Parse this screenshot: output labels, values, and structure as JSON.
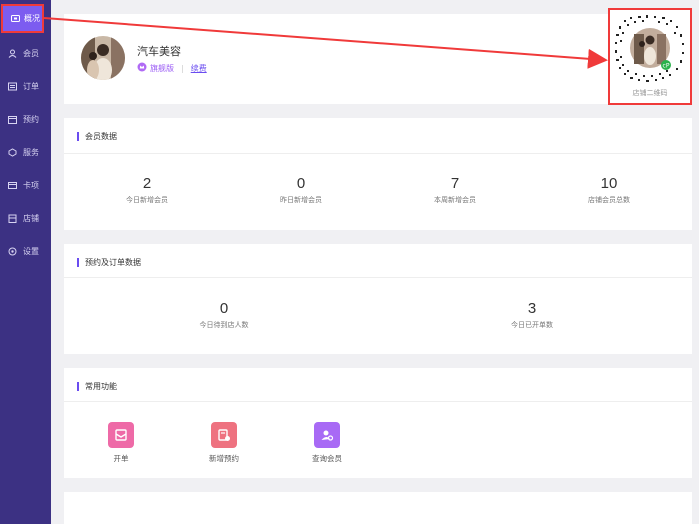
{
  "sidebar": {
    "items": [
      {
        "label": "概况",
        "icon": "dashboard-icon"
      },
      {
        "label": "会员",
        "icon": "member-icon"
      },
      {
        "label": "订单",
        "icon": "order-icon"
      },
      {
        "label": "预约",
        "icon": "appointment-icon"
      },
      {
        "label": "服务",
        "icon": "service-icon"
      },
      {
        "label": "卡项",
        "icon": "card-icon"
      },
      {
        "label": "店铺",
        "icon": "store-icon"
      },
      {
        "label": "设置",
        "icon": "settings-icon"
      }
    ]
  },
  "profile": {
    "shop_name": "汽车美容",
    "edition": "旗舰版",
    "renew": "续费",
    "qr_label": "店铺二维码"
  },
  "member_data": {
    "title": "会员数据",
    "stats": [
      {
        "value": "2",
        "label": "今日新增会员"
      },
      {
        "value": "0",
        "label": "昨日新增会员"
      },
      {
        "value": "7",
        "label": "本周新增会员"
      },
      {
        "value": "10",
        "label": "店铺会员总数"
      }
    ]
  },
  "booking_data": {
    "title": "预约及订单数据",
    "stats": [
      {
        "value": "0",
        "label": "今日待到店人数"
      },
      {
        "value": "3",
        "label": "今日已开单数"
      }
    ]
  },
  "functions": {
    "title": "常用功能",
    "items": [
      {
        "label": "开单",
        "color": "#ee6aa7"
      },
      {
        "label": "新增预约",
        "color": "#ee7280"
      },
      {
        "label": "查询会员",
        "color": "#a86af5"
      }
    ]
  },
  "colors": {
    "sidebar": "#3c3183",
    "accent": "#7c5cf0",
    "highlight_frame": "#f03a3a"
  }
}
